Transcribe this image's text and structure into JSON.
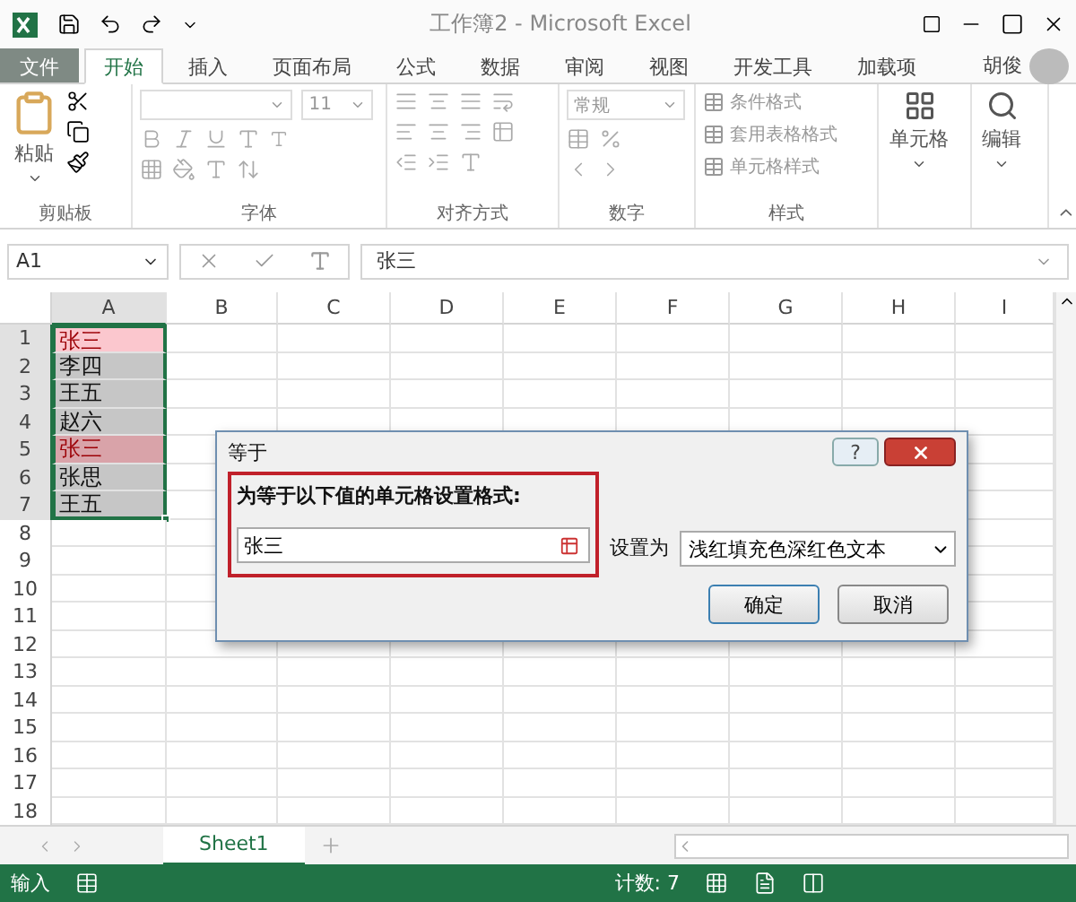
{
  "window": {
    "title": "工作簿2 - Microsoft Excel"
  },
  "tabs": [
    {
      "label": "文件",
      "kind": "file",
      "selected": false
    },
    {
      "label": "开始",
      "kind": "tab",
      "selected": true
    },
    {
      "label": "插入",
      "kind": "tab",
      "selected": false
    },
    {
      "label": "页面布局",
      "kind": "tab",
      "selected": false
    },
    {
      "label": "公式",
      "kind": "tab",
      "selected": false
    },
    {
      "label": "数据",
      "kind": "tab",
      "selected": false
    },
    {
      "label": "审阅",
      "kind": "tab",
      "selected": false
    },
    {
      "label": "视图",
      "kind": "tab",
      "selected": false
    },
    {
      "label": "开发工具",
      "kind": "tab",
      "selected": false
    },
    {
      "label": "加载项",
      "kind": "tab",
      "selected": false
    }
  ],
  "user": {
    "name": "胡俊"
  },
  "ribbon": {
    "groups": [
      {
        "kind": "clipboard",
        "label": "剪贴板",
        "button": "粘贴"
      },
      {
        "kind": "font",
        "label": "字体",
        "font_size": "11"
      },
      {
        "kind": "alignment",
        "label": "对齐方式"
      },
      {
        "kind": "number",
        "label": "数字",
        "format": "常规"
      },
      {
        "kind": "styles",
        "label": "样式",
        "items": [
          "条件格式",
          "套用表格格式",
          "单元格样式"
        ]
      },
      {
        "kind": "single",
        "button": "单元格"
      },
      {
        "kind": "single",
        "button": "编辑"
      }
    ]
  },
  "formula_bar": {
    "name_box": "A1",
    "value": "张三"
  },
  "grid": {
    "columns": [
      "A",
      "B",
      "C",
      "D",
      "E",
      "F",
      "G",
      "H",
      "I"
    ],
    "rows": [
      {
        "number": "1",
        "value": "张三",
        "highlighted": true,
        "selected": true,
        "active": true
      },
      {
        "number": "2",
        "value": "李四",
        "highlighted": false,
        "selected": true
      },
      {
        "number": "3",
        "value": "王五",
        "highlighted": false,
        "selected": true
      },
      {
        "number": "4",
        "value": "赵六",
        "highlighted": false,
        "selected": true
      },
      {
        "number": "5",
        "value": "张三",
        "highlighted": true,
        "selected": true
      },
      {
        "number": "6",
        "value": "张思",
        "highlighted": false,
        "selected": true
      },
      {
        "number": "7",
        "value": "王五",
        "highlighted": false,
        "selected": true
      },
      {
        "number": "8",
        "highlighted": false,
        "selected": false
      },
      {
        "number": "9",
        "highlighted": false,
        "selected": false
      },
      {
        "number": "10",
        "highlighted": false,
        "selected": false
      },
      {
        "number": "11",
        "highlighted": false,
        "selected": false
      },
      {
        "number": "12",
        "highlighted": false,
        "selected": false
      },
      {
        "number": "13",
        "highlighted": false,
        "selected": false
      },
      {
        "number": "14",
        "highlighted": false,
        "selected": false
      },
      {
        "number": "15",
        "highlighted": false,
        "selected": false
      },
      {
        "number": "16",
        "highlighted": false,
        "selected": false
      },
      {
        "number": "17",
        "highlighted": false,
        "selected": false
      },
      {
        "number": "18",
        "highlighted": false,
        "selected": false
      }
    ]
  },
  "dialog": {
    "title": "等于",
    "help": "?",
    "prompt": "为等于以下值的单元格设置格式:",
    "value": "张三",
    "with_label": "设置为",
    "format": "浅红填充色深红色文本",
    "buttons": [
      {
        "label": "确定",
        "selected": true
      },
      {
        "label": "取消",
        "selected": false
      }
    ]
  },
  "sheet_tabs": [
    {
      "label": "Sheet1",
      "selected": true
    }
  ],
  "status_bar": {
    "mode": "输入",
    "count": "计数: 7"
  }
}
